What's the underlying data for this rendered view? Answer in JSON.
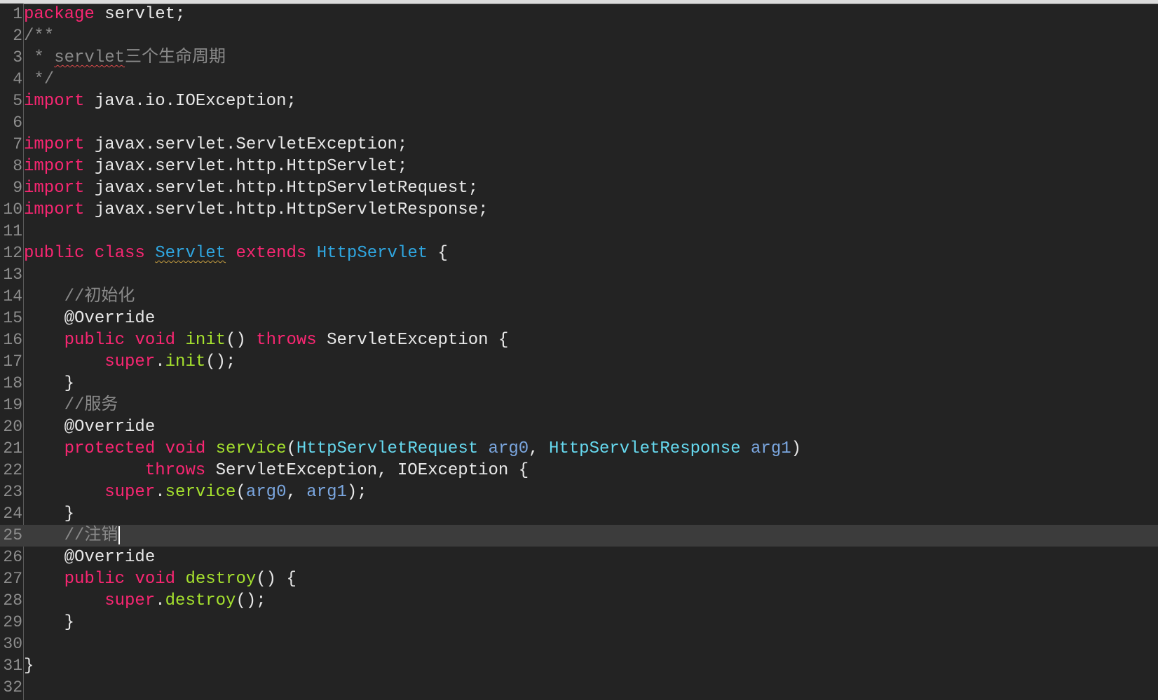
{
  "editor": {
    "language": "java",
    "current_line": 25,
    "theme_colors": {
      "background": "#232323",
      "keyword": "#f92672",
      "function": "#a6e22e",
      "type": "#66d9ef",
      "param": "#7ba7e0",
      "comment": "#8a8a8a"
    },
    "lines": [
      {
        "n": "1",
        "code": [
          {
            "t": "package",
            "c": "kw"
          },
          {
            "t": " servlet;",
            "c": "tx"
          }
        ]
      },
      {
        "n": "2",
        "code": [
          {
            "t": "/**",
            "c": "cm"
          }
        ]
      },
      {
        "n": "3",
        "code": [
          {
            "t": " * ",
            "c": "cm"
          },
          {
            "t": "servlet",
            "c": "cm sq"
          },
          {
            "t": "三个生命周期",
            "c": "cm"
          }
        ]
      },
      {
        "n": "4",
        "code": [
          {
            "t": " */",
            "c": "cm"
          }
        ]
      },
      {
        "n": "5",
        "code": [
          {
            "t": "import",
            "c": "kw"
          },
          {
            "t": " java.io.IOException;",
            "c": "tx"
          }
        ]
      },
      {
        "n": "6",
        "code": []
      },
      {
        "n": "7",
        "code": [
          {
            "t": "import",
            "c": "kw"
          },
          {
            "t": " javax.servlet.ServletException;",
            "c": "tx"
          }
        ]
      },
      {
        "n": "8",
        "code": [
          {
            "t": "import",
            "c": "kw"
          },
          {
            "t": " javax.servlet.http.HttpServlet;",
            "c": "tx"
          }
        ]
      },
      {
        "n": "9",
        "code": [
          {
            "t": "import",
            "c": "kw"
          },
          {
            "t": " javax.servlet.http.HttpServletRequest;",
            "c": "tx"
          }
        ]
      },
      {
        "n": "10",
        "code": [
          {
            "t": "import",
            "c": "kw"
          },
          {
            "t": " javax.servlet.http.HttpServletResponse;",
            "c": "tx"
          }
        ]
      },
      {
        "n": "11",
        "code": []
      },
      {
        "n": "12",
        "code": [
          {
            "t": "public",
            "c": "kw"
          },
          {
            "t": " ",
            "c": "tx"
          },
          {
            "t": "class",
            "c": "kw"
          },
          {
            "t": " ",
            "c": "tx"
          },
          {
            "t": "Servlet",
            "c": "ty cls sq"
          },
          {
            "t": " ",
            "c": "tx"
          },
          {
            "t": "extends",
            "c": "kw"
          },
          {
            "t": " ",
            "c": "tx"
          },
          {
            "t": "HttpServlet",
            "c": "ty cls"
          },
          {
            "t": " {",
            "c": "tx"
          }
        ]
      },
      {
        "n": "13",
        "code": []
      },
      {
        "n": "14",
        "code": [
          {
            "t": "    //初始化",
            "c": "cm"
          }
        ]
      },
      {
        "n": "15",
        "code": [
          {
            "t": "    @Override",
            "c": "an"
          }
        ]
      },
      {
        "n": "16",
        "code": [
          {
            "t": "    ",
            "c": "tx"
          },
          {
            "t": "public",
            "c": "kw"
          },
          {
            "t": " ",
            "c": "tx"
          },
          {
            "t": "void",
            "c": "kw"
          },
          {
            "t": " ",
            "c": "tx"
          },
          {
            "t": "init",
            "c": "fn"
          },
          {
            "t": "() ",
            "c": "tx"
          },
          {
            "t": "throws",
            "c": "kw"
          },
          {
            "t": " ServletException {",
            "c": "tx"
          }
        ]
      },
      {
        "n": "17",
        "code": [
          {
            "t": "        ",
            "c": "tx"
          },
          {
            "t": "super",
            "c": "kw"
          },
          {
            "t": ".",
            "c": "tx"
          },
          {
            "t": "init",
            "c": "fn"
          },
          {
            "t": "();",
            "c": "tx"
          }
        ]
      },
      {
        "n": "18",
        "code": [
          {
            "t": "    }",
            "c": "tx"
          }
        ]
      },
      {
        "n": "19",
        "code": [
          {
            "t": "    //服务",
            "c": "cm"
          }
        ]
      },
      {
        "n": "20",
        "code": [
          {
            "t": "    @Override",
            "c": "an"
          }
        ]
      },
      {
        "n": "21",
        "code": [
          {
            "t": "    ",
            "c": "tx"
          },
          {
            "t": "protected",
            "c": "kw"
          },
          {
            "t": " ",
            "c": "tx"
          },
          {
            "t": "void",
            "c": "kw"
          },
          {
            "t": " ",
            "c": "tx"
          },
          {
            "t": "service",
            "c": "fn"
          },
          {
            "t": "(",
            "c": "tx"
          },
          {
            "t": "HttpServletRequest",
            "c": "ty"
          },
          {
            "t": " ",
            "c": "tx"
          },
          {
            "t": "arg0",
            "c": "pm"
          },
          {
            "t": ", ",
            "c": "tx"
          },
          {
            "t": "HttpServletResponse",
            "c": "ty"
          },
          {
            "t": " ",
            "c": "tx"
          },
          {
            "t": "arg1",
            "c": "pm"
          },
          {
            "t": ")",
            "c": "tx"
          }
        ]
      },
      {
        "n": "22",
        "code": [
          {
            "t": "            ",
            "c": "tx"
          },
          {
            "t": "throws",
            "c": "kw"
          },
          {
            "t": " ServletException, IOException {",
            "c": "tx"
          }
        ]
      },
      {
        "n": "23",
        "code": [
          {
            "t": "        ",
            "c": "tx"
          },
          {
            "t": "super",
            "c": "kw"
          },
          {
            "t": ".",
            "c": "tx"
          },
          {
            "t": "service",
            "c": "fn"
          },
          {
            "t": "(",
            "c": "tx"
          },
          {
            "t": "arg0",
            "c": "pm"
          },
          {
            "t": ", ",
            "c": "tx"
          },
          {
            "t": "arg1",
            "c": "pm"
          },
          {
            "t": ");",
            "c": "tx"
          }
        ]
      },
      {
        "n": "24",
        "code": [
          {
            "t": "    }",
            "c": "tx"
          }
        ]
      },
      {
        "n": "25",
        "code": [
          {
            "t": "    //注销",
            "c": "cm"
          }
        ]
      },
      {
        "n": "26",
        "code": [
          {
            "t": "    @Override",
            "c": "an"
          }
        ]
      },
      {
        "n": "27",
        "code": [
          {
            "t": "    ",
            "c": "tx"
          },
          {
            "t": "public",
            "c": "kw"
          },
          {
            "t": " ",
            "c": "tx"
          },
          {
            "t": "void",
            "c": "kw"
          },
          {
            "t": " ",
            "c": "tx"
          },
          {
            "t": "destroy",
            "c": "fn"
          },
          {
            "t": "() {",
            "c": "tx"
          }
        ]
      },
      {
        "n": "28",
        "code": [
          {
            "t": "        ",
            "c": "tx"
          },
          {
            "t": "super",
            "c": "kw"
          },
          {
            "t": ".",
            "c": "tx"
          },
          {
            "t": "destroy",
            "c": "fn"
          },
          {
            "t": "();",
            "c": "tx"
          }
        ]
      },
      {
        "n": "29",
        "code": [
          {
            "t": "    }",
            "c": "tx"
          }
        ]
      },
      {
        "n": "30",
        "code": []
      },
      {
        "n": "31",
        "code": [
          {
            "t": "}",
            "c": "tx"
          }
        ]
      },
      {
        "n": "32",
        "code": []
      }
    ]
  }
}
